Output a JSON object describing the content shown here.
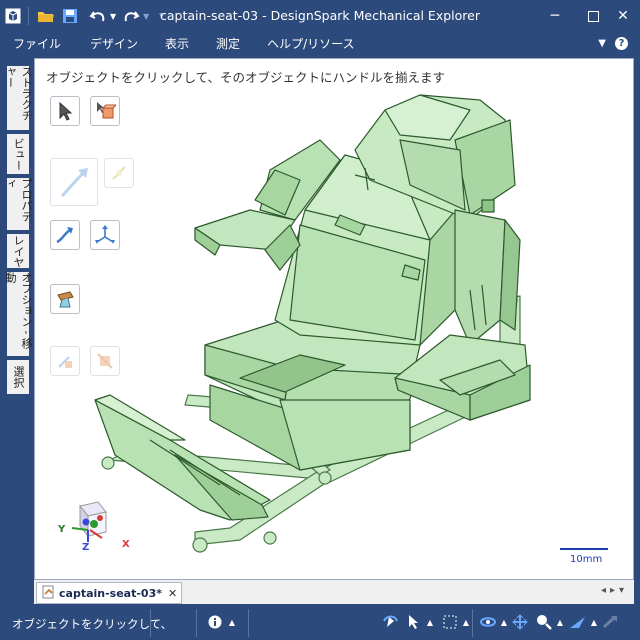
{
  "window": {
    "title": "captain-seat-03 - DesignSpark Mechanical Explorer"
  },
  "menu": {
    "items": [
      "ファイル",
      "デザイン",
      "表示",
      "測定",
      "ヘルプ/リソース"
    ]
  },
  "side_tabs": [
    "ストラクチャー",
    "ビュー",
    "プロパティ",
    "レイヤ",
    "オプション - 移動",
    "選択"
  ],
  "canvas": {
    "hint": "オブジェクトをクリックして、そのオブジェクトにハンドルを揃えます",
    "scale_label": "10mm",
    "triad": {
      "x": "X",
      "y": "Y",
      "z": "Z"
    }
  },
  "document_tab": {
    "label": "captain-seat-03*"
  },
  "status": {
    "text": "オブジェクトをクリックして、"
  },
  "colors": {
    "chrome": "#2c4a7c",
    "model": "#b8e0b4",
    "model_edge": "#2d5a2d"
  }
}
